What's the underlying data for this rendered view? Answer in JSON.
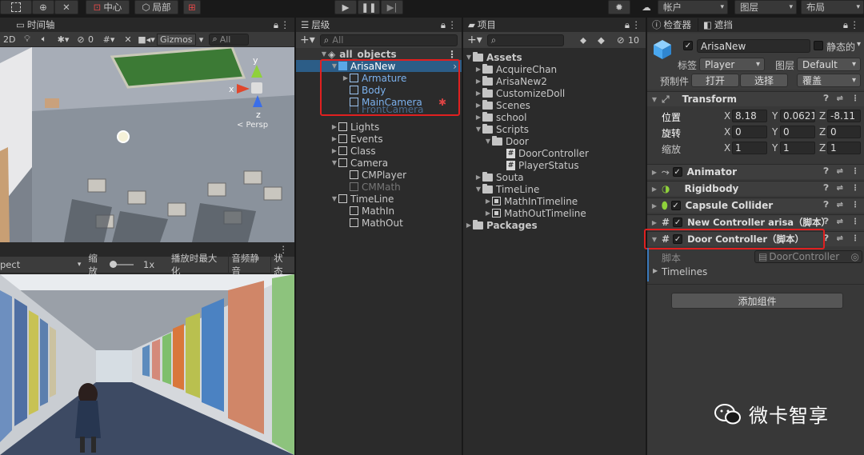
{
  "toolbar": {
    "center_label": "中心",
    "local_label": "局部",
    "account_label": "帐户",
    "layers_label": "图层",
    "layout_label": "布局"
  },
  "scene": {
    "tab_label": "时间轴",
    "mode_2d": "2D",
    "gizmos_label": "Gizmos",
    "search_placeholder": "All",
    "persp_label": "< Persp",
    "hidden_count": "0",
    "axis_x": "x",
    "axis_y": "y",
    "axis_z": "z"
  },
  "game": {
    "aspect_label": "pect",
    "scale_label": "缩放",
    "scale_value": "1x",
    "maximize_label": "播放时最大化",
    "mute_label": "音频静音",
    "stats_label": "状态"
  },
  "hierarchy": {
    "tab_label": "层级",
    "search_placeholder": "All",
    "root": "all_objects",
    "items": [
      {
        "label": "ArisaNew",
        "expanded": true
      },
      {
        "label": "Armature"
      },
      {
        "label": "Body"
      },
      {
        "label": "MainCamera"
      },
      {
        "label": "FrontCamera"
      },
      {
        "label": "Lights"
      },
      {
        "label": "Events"
      },
      {
        "label": "Class"
      },
      {
        "label": "Camera",
        "expanded": true
      },
      {
        "label": "CMPlayer"
      },
      {
        "label": "CMMath"
      },
      {
        "label": "TimeLine",
        "expanded": true
      },
      {
        "label": "MathIn"
      },
      {
        "label": "MathOut"
      }
    ]
  },
  "project": {
    "tab_label": "项目",
    "hidden_count": "10",
    "items": [
      {
        "label": "Assets"
      },
      {
        "label": "AcquireChan"
      },
      {
        "label": "ArisaNew2"
      },
      {
        "label": "CustomizeDoll"
      },
      {
        "label": "Scenes"
      },
      {
        "label": "school"
      },
      {
        "label": "Scripts"
      },
      {
        "label": "Door"
      },
      {
        "label": "DoorController"
      },
      {
        "label": "PlayerStatus"
      },
      {
        "label": "Souta"
      },
      {
        "label": "TimeLine"
      },
      {
        "label": "MathInTimeline"
      },
      {
        "label": "MathOutTimeline"
      },
      {
        "label": "Packages"
      }
    ]
  },
  "inspector": {
    "tab_label": "检查器",
    "tab2_label": "遮挡",
    "object_name": "ArisaNew",
    "static_label": "静态的",
    "tag_label": "标签",
    "tag_value": "Player",
    "layer_label": "图层",
    "layer_value": "Default",
    "prefab_label": "预制件",
    "open_label": "打开",
    "select_label": "选择",
    "overrides_label": "覆盖",
    "transform": {
      "title": "Transform",
      "position_label": "位置",
      "rotation_label": "旋转",
      "scale_label": "缩放",
      "position": {
        "x": "8.18",
        "y": "0.06214",
        "z": "-8.11"
      },
      "rotation": {
        "x": "0",
        "y": "0",
        "z": "0"
      },
      "scale": {
        "x": "1",
        "y": "1",
        "z": "1"
      }
    },
    "components": [
      {
        "title": "Animator"
      },
      {
        "title": "Rigidbody"
      },
      {
        "title": "Capsule Collider"
      },
      {
        "title": "New Controller arisa（脚本）"
      },
      {
        "title": "Door Controller（脚本）"
      }
    ],
    "script_label": "脚本",
    "script_value": "DoorController",
    "timelines_label": "Timelines",
    "add_component_label": "添加组件"
  },
  "watermark": {
    "text": "微卡智享"
  },
  "colors": {
    "highlight_red": "#e02020",
    "selection_blue": "#2c5d87",
    "link_blue": "#7cb2ee",
    "component_header": "#3e3e3e"
  }
}
